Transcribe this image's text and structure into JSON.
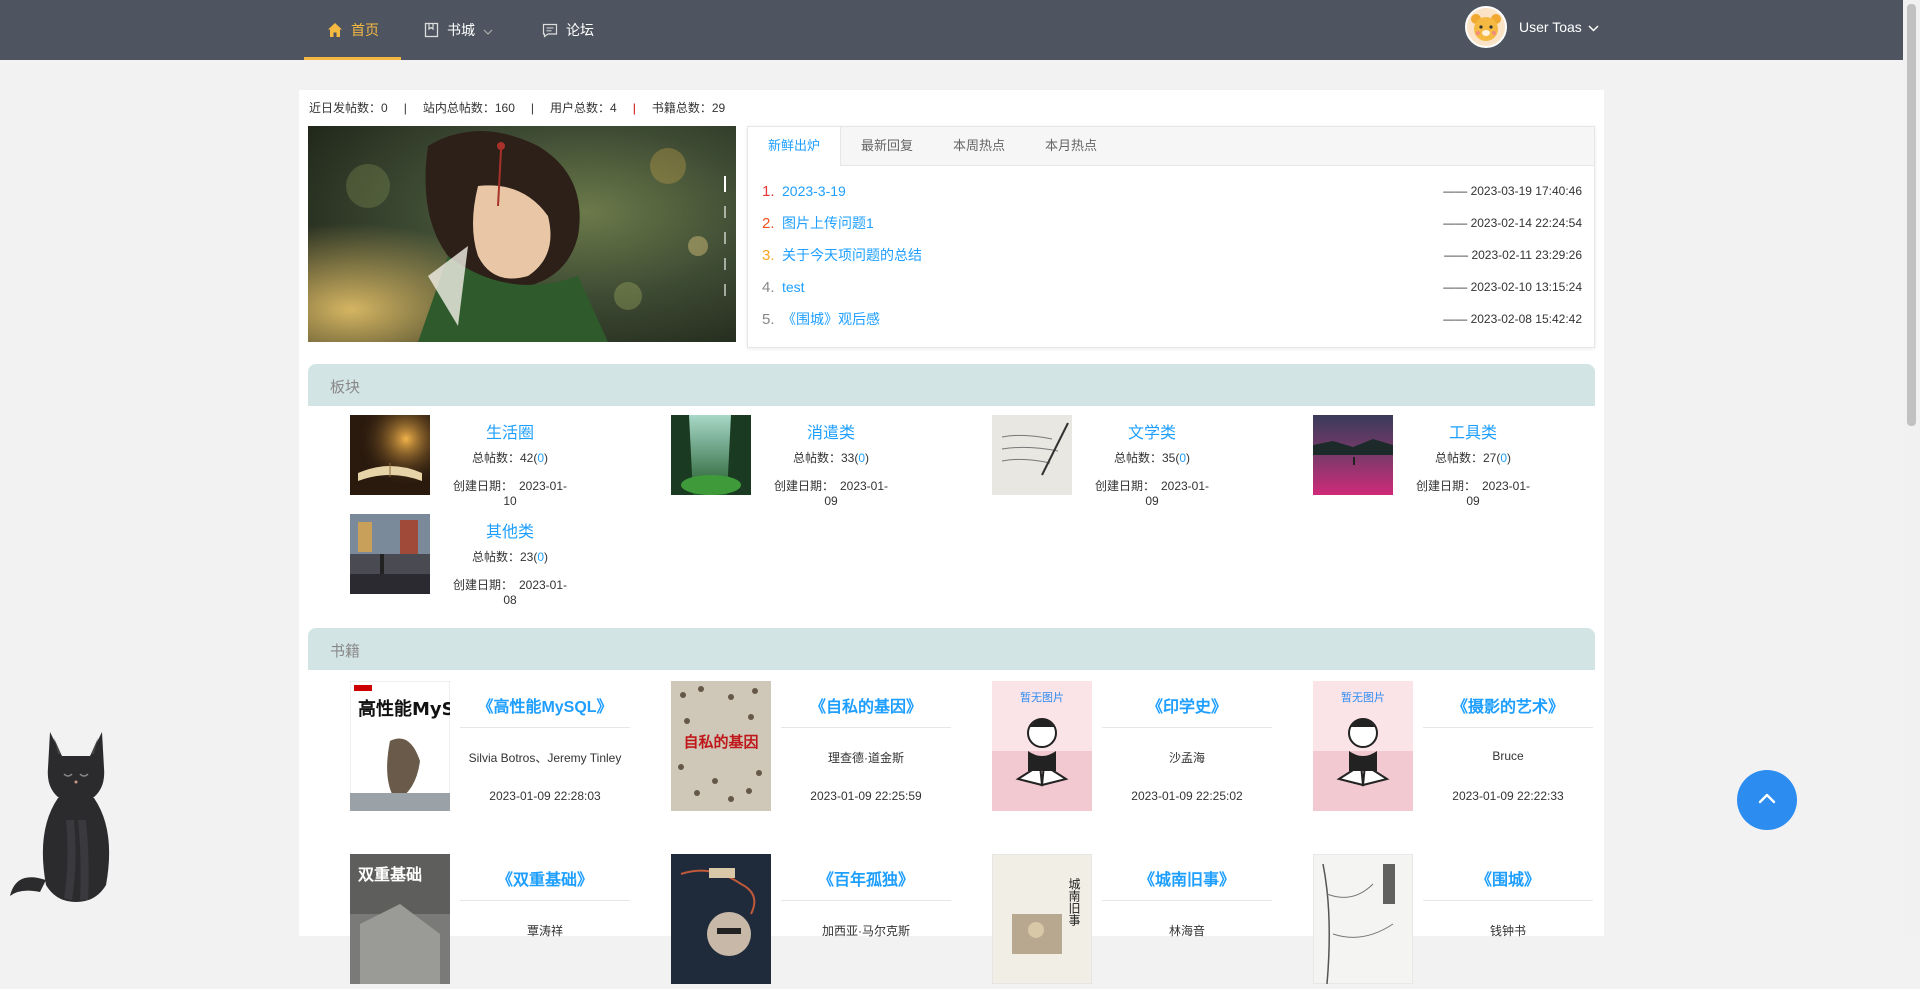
{
  "nav": {
    "home": "首页",
    "books": "书城",
    "forum": "论坛",
    "user_name": "User Toas"
  },
  "stats": {
    "recent_label": "近日发帖数：",
    "recent_value": "0",
    "total_posts_label": "站内总帖数：",
    "total_posts_value": "160",
    "users_label": "用户总数：",
    "users_value": "4",
    "books_label": "书籍总数：",
    "books_value": "29",
    "separator": "|"
  },
  "tabs": [
    "新鲜出炉",
    "最新回复",
    "本周热点",
    "本月热点"
  ],
  "posts": [
    {
      "num": "1.",
      "title": "2023-3-19",
      "time": "—— 2023-03-19 17:40:46",
      "color": "#e53935"
    },
    {
      "num": "2.",
      "title": "图片上传问题1",
      "time": "—— 2023-02-14 22:24:54",
      "color": "#f4511e"
    },
    {
      "num": "3.",
      "title": "关于今天项问题的总结",
      "time": "—— 2023-02-11 23:29:26",
      "color": "#f5a623"
    },
    {
      "num": "4.",
      "title": "test",
      "time": "—— 2023-02-10 13:15:24",
      "color": "#888888"
    },
    {
      "num": "5.",
      "title": "《围城》观后感",
      "time": "—— 2023-02-08 15:42:42",
      "color": "#888888"
    }
  ],
  "sections": {
    "boards": "板块",
    "books": "书籍"
  },
  "board_labels": {
    "posts": "总帖数：",
    "created": "创建日期："
  },
  "boards": [
    {
      "name": "生活圈",
      "posts": "42",
      "new": "0",
      "date": "2023-01-10"
    },
    {
      "name": "消遣类",
      "posts": "33",
      "new": "0",
      "date": "2023-01-09"
    },
    {
      "name": "文学类",
      "posts": "35",
      "new": "0",
      "date": "2023-01-09"
    },
    {
      "name": "工具类",
      "posts": "27",
      "new": "0",
      "date": "2023-01-09"
    },
    {
      "name": "其他类",
      "posts": "23",
      "new": "0",
      "date": "2023-01-08"
    }
  ],
  "books": [
    {
      "title": "《高性能MySQL》",
      "author": "Silvia Botros、Jeremy Tinley",
      "date": "2023-01-09 22:28:03",
      "cover_text": "高性能MySQL"
    },
    {
      "title": "《自私的基因》",
      "author": "理查德·道金斯",
      "date": "2023-01-09 22:25:59",
      "cover_text": "自私的基因"
    },
    {
      "title": "《印学史》",
      "author": "沙孟海",
      "date": "2023-01-09 22:25:02",
      "cover_text": "暂无图片"
    },
    {
      "title": "《摄影的艺术》",
      "author": "Bruce",
      "date": "2023-01-09 22:22:33",
      "cover_text": "暂无图片"
    },
    {
      "title": "《双重基础》",
      "author": "覃涛祥",
      "date": "",
      "cover_text": "双重基础"
    },
    {
      "title": "《百年孤独》",
      "author": "加西亚·马尔克斯",
      "date": "",
      "cover_text": ""
    },
    {
      "title": "《城南旧事》",
      "author": "林海音",
      "date": "",
      "cover_text": "城南旧事"
    },
    {
      "title": "《围城》",
      "author": "钱钟书",
      "date": "",
      "cover_text": ""
    }
  ]
}
